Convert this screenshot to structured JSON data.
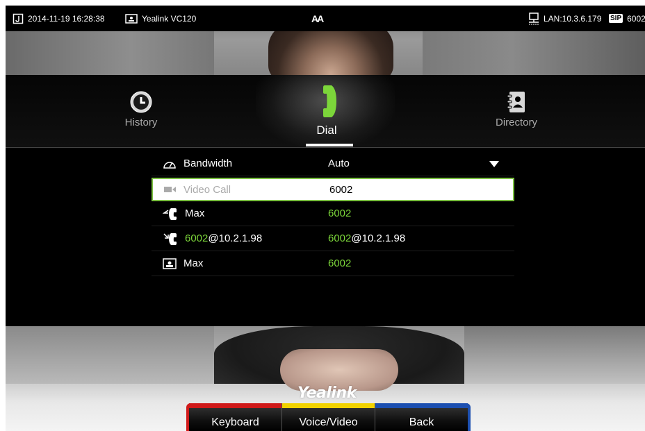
{
  "statusbar": {
    "datetime": "2014-11-19 16:28:38",
    "model": "Yealink VC120",
    "aa": "AA",
    "lan": "LAN:10.3.6.179",
    "sip_badge": "SIP",
    "sip_account": "6002"
  },
  "tabs": [
    {
      "label": "History",
      "icon": "clock-icon"
    },
    {
      "label": "Dial",
      "icon": "phone-handset-icon",
      "active": true
    },
    {
      "label": "Directory",
      "icon": "contacts-book-icon"
    }
  ],
  "list": {
    "bandwidth": {
      "label": "Bandwidth",
      "value": "Auto",
      "icon": "gauge-icon"
    },
    "rows": [
      {
        "label": "Video Call",
        "value": "6002",
        "icon": "video-camera-icon",
        "selected": true
      },
      {
        "label": "Max",
        "value": "6002",
        "icon": "missed-call-icon"
      },
      {
        "label_highlight": "6002",
        "label_rest": "@10.2.1.98",
        "value_highlight": "6002",
        "value_rest": "@10.2.1.98",
        "icon": "incoming-call-icon"
      },
      {
        "label": "Max",
        "value": "6002",
        "icon": "contact-card-icon"
      }
    ]
  },
  "logo": "Yealink",
  "softkeys": {
    "keyboard": "Keyboard",
    "voice_video": "Voice/Video",
    "back": "Back"
  },
  "colors": {
    "accent_green": "#7cd63a",
    "softkey_red": "#d01a1a",
    "softkey_yellow": "#f2d200",
    "softkey_blue": "#1c4fb0"
  }
}
